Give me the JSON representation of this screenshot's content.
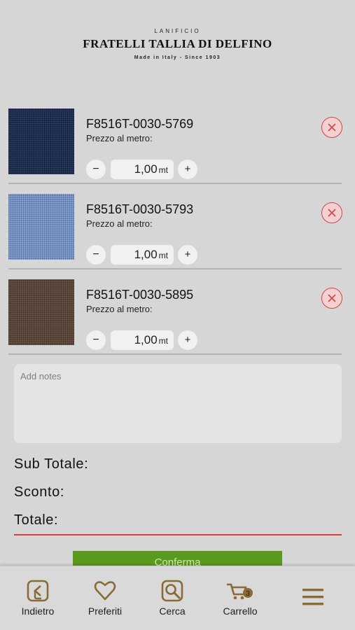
{
  "brand": {
    "top": "LANIFICIO",
    "name": "FRATELLI TALLIA DI DELFINO",
    "sub": "Made in Italy - Since 1903"
  },
  "cart_items": [
    {
      "code": "F8516T-0030-5769",
      "price_label": "Prezzo al metro:",
      "quantity": "1,00",
      "unit": "mt",
      "swatch_color": "#1c2d52"
    },
    {
      "code": "F8516T-0030-5793",
      "price_label": "Prezzo al metro:",
      "quantity": "1,00",
      "unit": "mt",
      "swatch_color": "#7290c2"
    },
    {
      "code": "F8516T-0030-5895",
      "price_label": "Prezzo al metro:",
      "quantity": "1,00",
      "unit": "mt",
      "swatch_color": "#5b4538"
    }
  ],
  "stepper": {
    "minus": "−",
    "plus": "+"
  },
  "notes": {
    "placeholder": "Add notes"
  },
  "summary": {
    "subtotal_label": "Sub Totale:",
    "discount_label": "Sconto:",
    "total_label": "Totale:"
  },
  "confirm_label": "Conferma",
  "tabbar": {
    "items": [
      {
        "label": "Indietro",
        "icon": "back-arrow-icon"
      },
      {
        "label": "Preferiti",
        "icon": "heart-icon"
      },
      {
        "label": "Cerca",
        "icon": "search-icon"
      },
      {
        "label": "Carrello",
        "icon": "cart-icon",
        "badge": "3"
      },
      {
        "label": "",
        "icon": "hamburger-menu-icon"
      }
    ]
  },
  "colors": {
    "accent": "#8a6a36",
    "remove": "#d0454a",
    "confirm": "#5a9a1e",
    "total_underline": "#e0393e"
  }
}
